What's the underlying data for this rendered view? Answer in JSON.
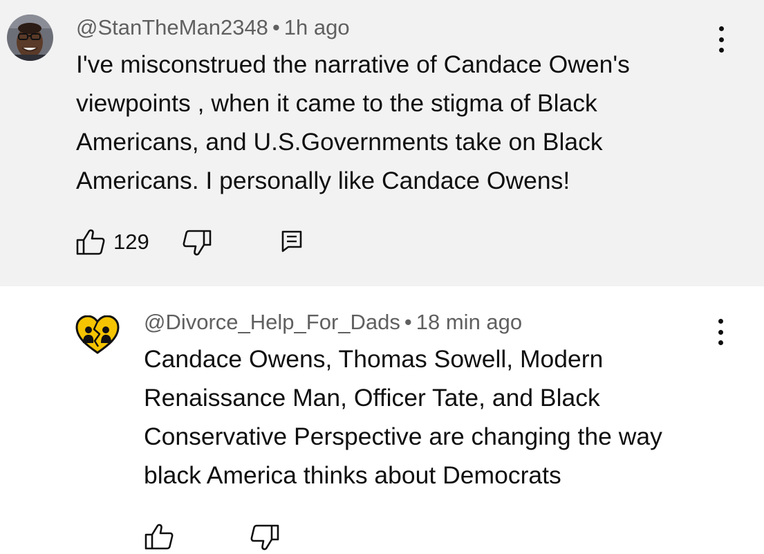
{
  "comments": [
    {
      "handle": "@StanTheMan2348",
      "separator": "•",
      "timestamp": "1h ago",
      "lines": [
        "I've misconstrued the narrative of  Candace Owen's",
        "viewpoints , when it came to the stigma of Black",
        "Americans, and U.S.Governments take on Black",
        "Americans. I personally like Candace Owens!"
      ],
      "like_count": "129",
      "avatar_icon": "user-photo-avatar",
      "actions": [
        "thumbs-up-icon",
        "thumbs-down-icon",
        "reply-icon",
        "more-options-icon"
      ]
    },
    {
      "handle": "@Divorce_Help_For_Dads",
      "separator": "•",
      "timestamp": "18 min ago",
      "lines": [
        "Candace Owens, Thomas Sowell, Modern",
        "Renaissance Man, Officer Tate, and Black",
        "Conservative Perspective are changing the way",
        "black America thinks about Democrats"
      ],
      "avatar_icon": "broken-heart-logo-avatar",
      "actions": [
        "thumbs-up-icon",
        "thumbs-down-icon",
        "more-options-icon"
      ]
    }
  ],
  "colors": {
    "main_background": "#f2f2f2",
    "reply_background": "#ffffff",
    "meta_text": "#606060",
    "body_text": "#0f0f0f",
    "heart_yellow": "#f5c400"
  }
}
